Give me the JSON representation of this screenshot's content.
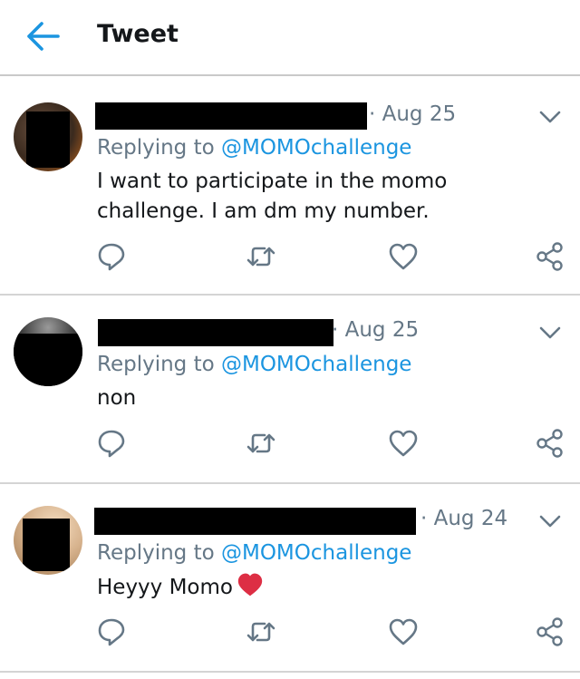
{
  "header": {
    "title": "Tweet"
  },
  "tweets": [
    {
      "date_prefix": "·",
      "date": "Aug 25",
      "replying_prefix": "Replying to",
      "mention": "@MOMOchallenge",
      "text": "I want to participate in the momo challenge. I am dm my number."
    },
    {
      "date_prefix": "·",
      "date": "Aug 25",
      "replying_prefix": "Replying to",
      "mention": "@MOMOchallenge",
      "text": "non"
    },
    {
      "date_prefix": "·",
      "date": "Aug 24",
      "replying_prefix": "Replying to",
      "mention": "@MOMOchallenge",
      "text": "Heyyy Momo",
      "emoji": "red-heart-icon"
    }
  ],
  "icons": {
    "back": "arrow-left-icon",
    "more": "chevron-down-icon",
    "reply": "reply-icon",
    "retweet": "retweet-icon",
    "like": "heart-icon",
    "share": "share-icon"
  },
  "colors": {
    "accent": "#1b95e0",
    "secondary_text": "#657786",
    "primary_text": "#14171a",
    "heart_emoji": "#dd2e44"
  }
}
